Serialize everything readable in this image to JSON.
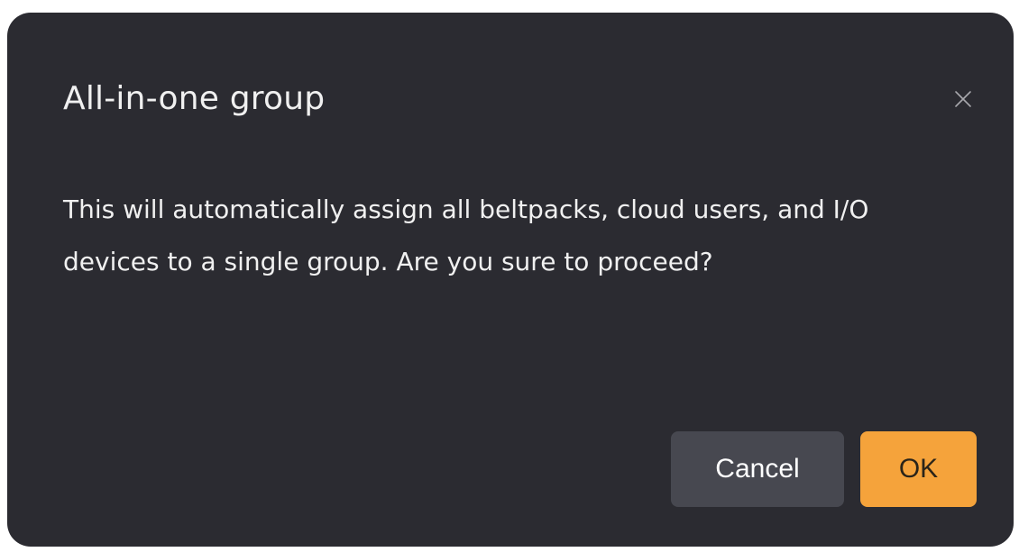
{
  "dialog": {
    "title": "All-in-one group",
    "message": "This will automatically assign all beltpacks, cloud users, and I/O devices to a single group. Are you sure to proceed?",
    "close_icon": "close-icon",
    "buttons": {
      "cancel_label": "Cancel",
      "ok_label": "OK"
    }
  },
  "colors": {
    "dialog_background": "#2b2b31",
    "text": "#f0f0f0",
    "cancel_button": "#474850",
    "ok_button": "#f5a33b"
  }
}
